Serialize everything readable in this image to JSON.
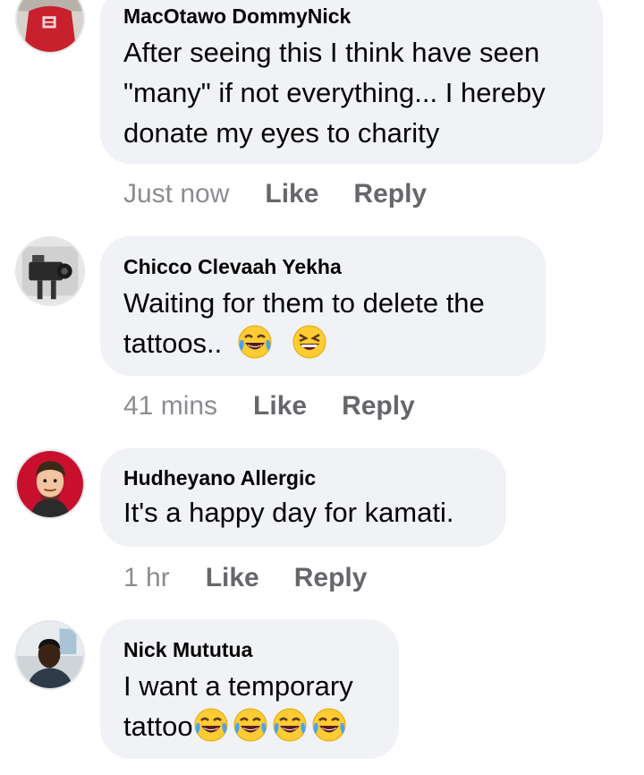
{
  "comments": [
    {
      "author": "MacOtawo DommyNick",
      "text": "After seeing this I think have seen \"many\" if not everything... I hereby donate my eyes to charity",
      "line1": "After seeing this I think have seen",
      "line2": "\"many\" if not everything... I hereby",
      "line3": "donate my eyes to charity",
      "time": "Just now",
      "like": "Like",
      "reply": "Reply",
      "avatar": "red-shirt-person-avatar"
    },
    {
      "author": "Chicco Clevaah Yekha",
      "line1": "Waiting for them to delete the",
      "line2": "tattoos..",
      "emojis": [
        "face-with-tears-of-joy-emoji",
        "grinning-squinting-face-emoji"
      ],
      "time": "41 mins",
      "like": "Like",
      "reply": "Reply",
      "avatar": "camera-gear-avatar"
    },
    {
      "author": "Hudheyano Allergic",
      "line1": "It's a happy day for kamati.",
      "time": "1 hr",
      "like": "Like",
      "reply": "Reply",
      "avatar": "cartoon-man-avatar"
    },
    {
      "author": "Nick Mututua",
      "line1": "I want a temporary",
      "line2": "tattoo",
      "emojis": [
        "face-with-tears-of-joy-emoji",
        "face-with-tears-of-joy-emoji",
        "face-with-tears-of-joy-emoji",
        "face-with-tears-of-joy-emoji"
      ],
      "avatar": "selfie-man-avatar"
    }
  ],
  "colors": {
    "bubble": "#f0f2f5",
    "text": "#050505",
    "time": "#8a8d91",
    "action": "#65676b"
  }
}
